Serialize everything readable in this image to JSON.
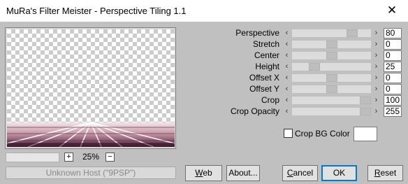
{
  "window": {
    "title": "MuRa's Filter Meister - Perspective Tiling 1.1",
    "close_glyph": "✕"
  },
  "zoom": {
    "plus": "+",
    "minus": "−",
    "level": "25%"
  },
  "host_status": "Unknown Host (\"9PSP\")",
  "parameters": [
    {
      "label": "Perspective",
      "value": "80",
      "level": 0.8
    },
    {
      "label": "Stretch",
      "value": "0",
      "level": 0.5
    },
    {
      "label": "Center",
      "value": "0",
      "level": 0.5
    },
    {
      "label": "Height",
      "value": "25",
      "level": 0.25
    },
    {
      "label": "Offset X",
      "value": "0",
      "level": 0.5
    },
    {
      "label": "Offset Y",
      "value": "0",
      "level": 0.5
    },
    {
      "label": "Crop",
      "value": "100",
      "level": 1.0
    },
    {
      "label": "Crop Opacity",
      "value": "255",
      "level": 1.0
    }
  ],
  "arrows": {
    "left": "‹",
    "right": "›"
  },
  "crop_bg": {
    "label": "Crop BG Color",
    "checked": false,
    "color": "#ffffff"
  },
  "buttons": {
    "web": "Web",
    "about": "About...",
    "cancel": "Cancel",
    "ok": "OK",
    "reset": "Reset"
  }
}
